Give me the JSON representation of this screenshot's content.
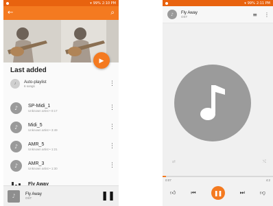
{
  "left_screen": {
    "status": {
      "time": "2:10 PM",
      "battery": "99%"
    },
    "toolbar": {
      "back_icon": "arrow-left-icon",
      "search_icon": "search-icon"
    },
    "fab": {
      "icon": "play-icon"
    },
    "section_title": "Last added",
    "playlist": {
      "title": "Auto-playlist",
      "subtitle": "6 songs"
    },
    "songs": [
      {
        "title": "SP-Midi_1",
        "subtitle": "Unknown artist • 0:17"
      },
      {
        "title": "Midi_5",
        "subtitle": "Unknown artist • 3:49"
      },
      {
        "title": "AMR_5",
        "subtitle": "Unknown artist • 1:21"
      },
      {
        "title": "AMR_3",
        "subtitle": "Unknown artist • 1:30"
      },
      {
        "title": "Fly Away",
        "subtitle": ""
      }
    ],
    "mini_player": {
      "title": "Fly Away",
      "subtitle": "OST"
    }
  },
  "right_screen": {
    "status": {
      "time": "2:11 PM",
      "battery": "99%"
    },
    "header": {
      "title": "Fly Away",
      "subtitle": "OST"
    },
    "progress": {
      "elapsed": "0:07",
      "total": "4:2",
      "fraction": 0.03
    },
    "accent": "#f47a20"
  }
}
